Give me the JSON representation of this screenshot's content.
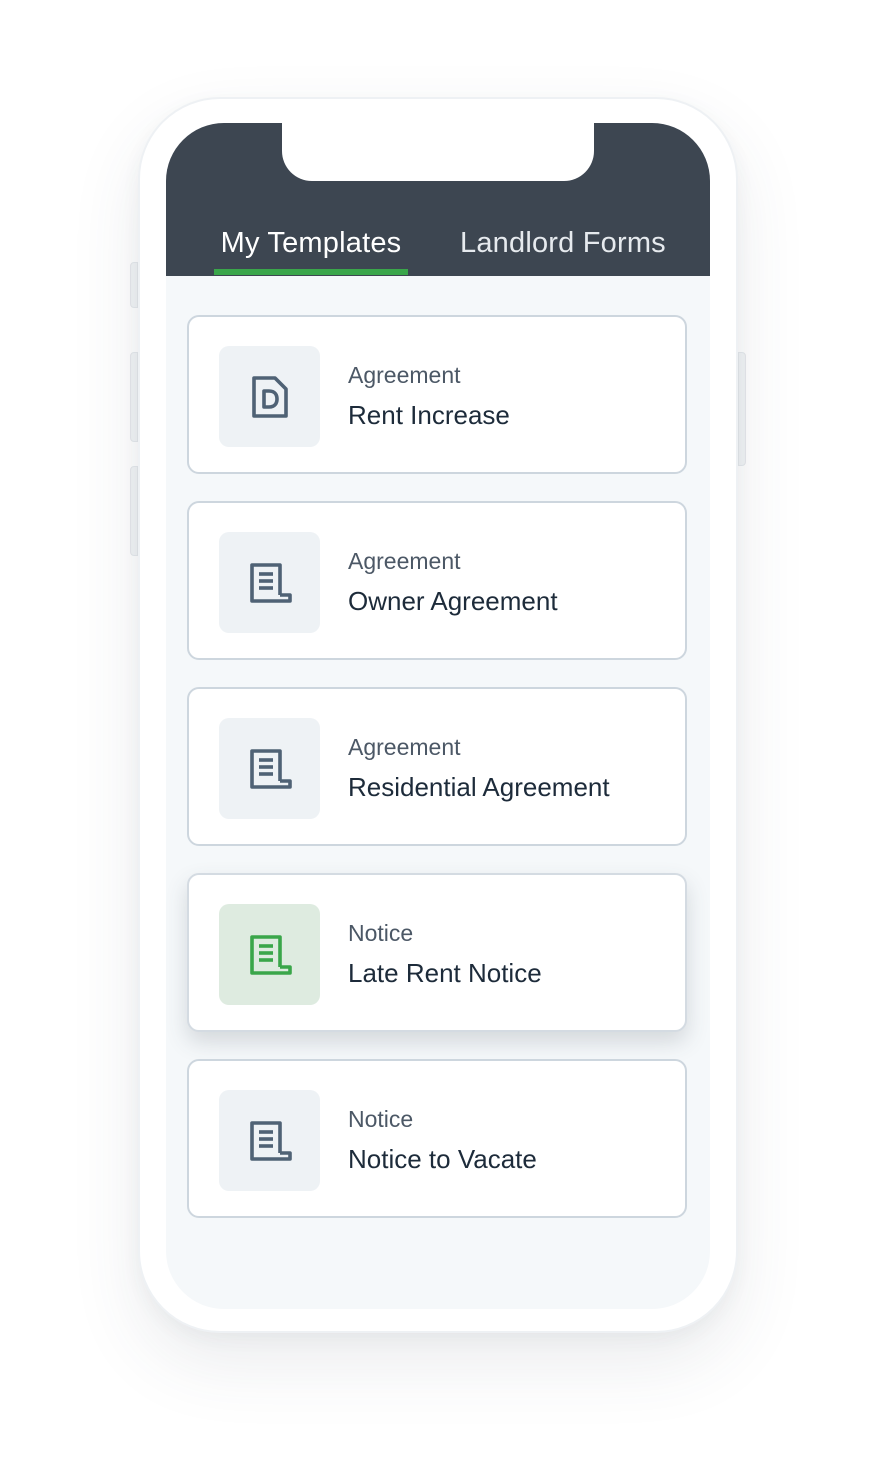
{
  "tabs": [
    {
      "label": "My Templates",
      "active": true
    },
    {
      "label": "Landlord Forms",
      "active": false
    }
  ],
  "colors": {
    "header": "#3d4651",
    "accent": "#3aa64a",
    "icon_default": "#4f6275",
    "icon_selected": "#3aa64a"
  },
  "templates": [
    {
      "type": "Agreement",
      "title": "Rent Increase",
      "icon": "document-d-icon",
      "selected": false
    },
    {
      "type": "Agreement",
      "title": "Owner Agreement",
      "icon": "document-lines-icon",
      "selected": false
    },
    {
      "type": "Agreement",
      "title": "Residential Agreement",
      "icon": "document-lines-icon",
      "selected": false
    },
    {
      "type": "Notice",
      "title": "Late Rent Notice",
      "icon": "document-lines-icon",
      "selected": true
    },
    {
      "type": "Notice",
      "title": "Notice to Vacate",
      "icon": "document-lines-icon",
      "selected": false
    }
  ]
}
